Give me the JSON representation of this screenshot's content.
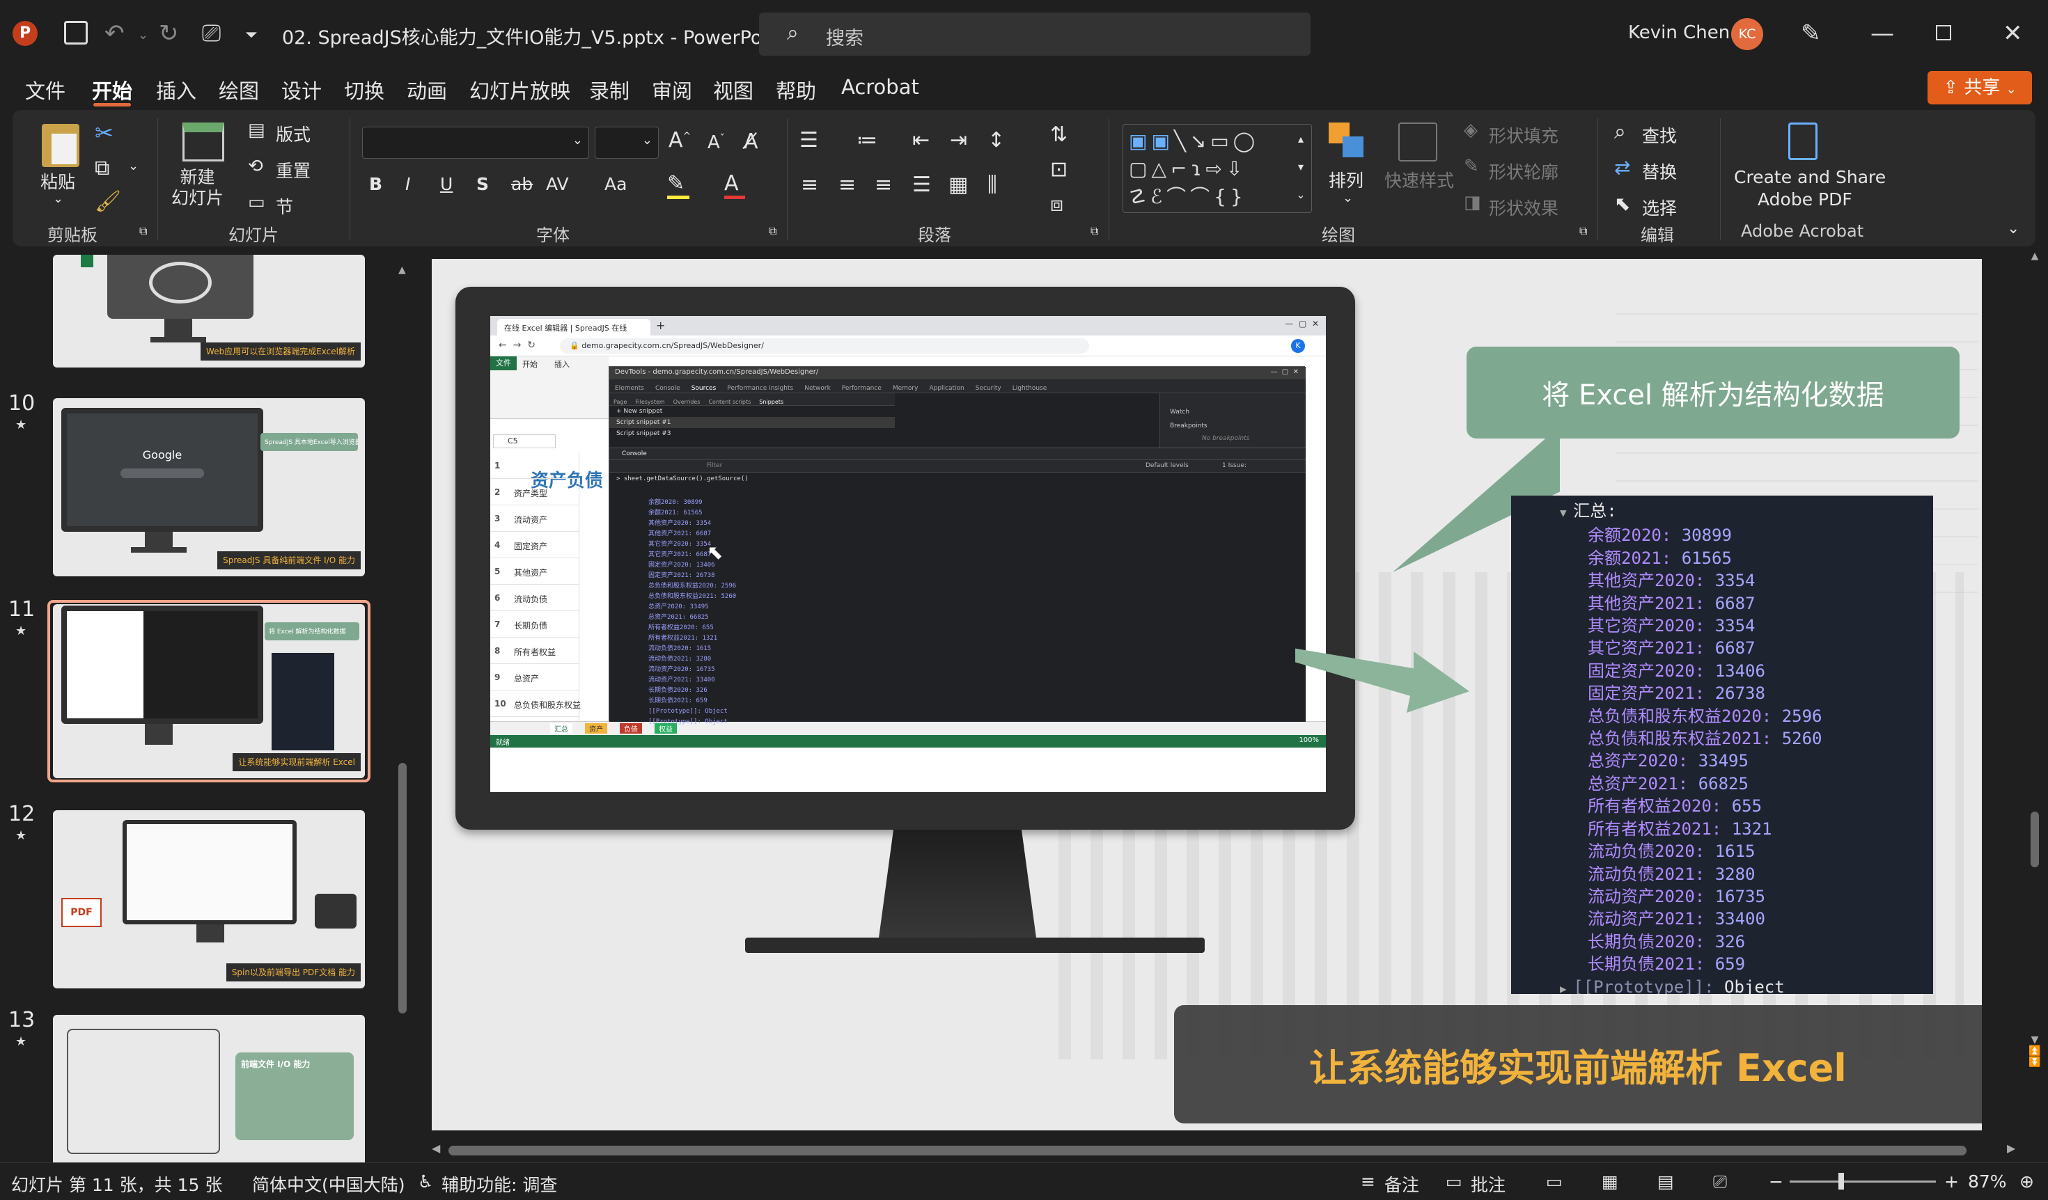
{
  "titlebar": {
    "app_icon": "powerpoint-icon",
    "filename": "02. SpreadJS核心能力_文件IO能力_V5.pptx",
    "separator": "-",
    "app_name": "PowerPoint",
    "search_placeholder": "搜索",
    "user_name": "Kevin Chen",
    "user_initials": "KC"
  },
  "menu": {
    "items": [
      "文件",
      "开始",
      "插入",
      "绘图",
      "设计",
      "切换",
      "动画",
      "幻灯片放映",
      "录制",
      "审阅",
      "视图",
      "帮助",
      "Acrobat"
    ],
    "active": "开始",
    "share_label": "共享"
  },
  "ribbon": {
    "clipboard": {
      "paste": "粘贴",
      "group": "剪贴板"
    },
    "slides": {
      "new_slide": "新建\n幻灯片",
      "layout": "版式",
      "reset": "重置",
      "section": "节",
      "group": "幻灯片"
    },
    "font": {
      "group": "字体",
      "aa": "Aa"
    },
    "paragraph": {
      "group": "段落"
    },
    "drawing": {
      "arrange": "排列",
      "quick_styles": "快速样式",
      "shape_fill": "形状填充",
      "shape_outline": "形状轮廓",
      "shape_effects": "形状效果",
      "group": "绘图"
    },
    "editing": {
      "find": "查找",
      "replace": "替换",
      "select": "选择",
      "group": "编辑"
    },
    "acrobat": {
      "create_share": "Create and Share",
      "adobe_pdf": "Adobe PDF",
      "group": "Adobe Acrobat"
    }
  },
  "thumbnails": [
    {
      "num": "",
      "banner": "Web应用可以在浏览器端完成Excel解析"
    },
    {
      "num": "10",
      "banner": "SpreadJS 具备纯前端文件 I/O 能力",
      "bubble": "SpreadJS 具本地Excel导入浏览器"
    },
    {
      "num": "11",
      "banner": "让系统能够实现前端解析 Excel",
      "bubble": "将 Excel 解析为结构化数据"
    },
    {
      "num": "12",
      "banner": "Spin以及前端导出 PDF文档 能力"
    },
    {
      "num": "13",
      "title": "前端文件 I/O 能力"
    }
  ],
  "slide": {
    "bubble_text": "将 Excel 解析为结构化数据",
    "bottom_banner": "让系统能够实现前端解析 Excel",
    "code_lines": [
      {
        "k": "汇总:",
        "v": "",
        "indent": 0
      },
      {
        "k": "余额2020:",
        "v": "30899",
        "indent": 1
      },
      {
        "k": "余额2021:",
        "v": "61565",
        "indent": 1
      },
      {
        "k": "其他资产2020:",
        "v": "3354",
        "indent": 1
      },
      {
        "k": "其他资产2021:",
        "v": "6687",
        "indent": 1
      },
      {
        "k": "其它资产2020:",
        "v": "3354",
        "indent": 1
      },
      {
        "k": "其它资产2021:",
        "v": "6687",
        "indent": 1
      },
      {
        "k": "固定资产2020:",
        "v": "13406",
        "indent": 1
      },
      {
        "k": "固定资产2021:",
        "v": "26738",
        "indent": 1
      },
      {
        "k": "总负债和股东权益2020:",
        "v": "2596",
        "indent": 1
      },
      {
        "k": "总负债和股东权益2021:",
        "v": "5260",
        "indent": 1
      },
      {
        "k": "总资产2020:",
        "v": "33495",
        "indent": 1
      },
      {
        "k": "总资产2021:",
        "v": "66825",
        "indent": 1
      },
      {
        "k": "所有者权益2020:",
        "v": "655",
        "indent": 1
      },
      {
        "k": "所有者权益2021:",
        "v": "1321",
        "indent": 1
      },
      {
        "k": "流动负债2020:",
        "v": "1615",
        "indent": 1
      },
      {
        "k": "流动负债2021:",
        "v": "3280",
        "indent": 1
      },
      {
        "k": "流动资产2020:",
        "v": "16735",
        "indent": 1
      },
      {
        "k": "流动资产2021:",
        "v": "33400",
        "indent": 1
      },
      {
        "k": "长期负债2020:",
        "v": "326",
        "indent": 1
      },
      {
        "k": "长期负债2021:",
        "v": "659",
        "indent": 1
      },
      {
        "k": "[[Prototype]]:",
        "v": "Object",
        "indent": 0
      }
    ],
    "browser": {
      "tab": "在线 Excel 编辑器 | SpreadJS 在线",
      "url": "demo.grapecity.com.cn/SpreadJS/WebDesigner/",
      "devtools_title": "DevTools - demo.grapecity.com.cn/SpreadJS/WebDesigner/",
      "dev_tabs": [
        "Elements",
        "Console",
        "Sources",
        "Performance insights",
        "Network",
        "Performance",
        "Memory",
        "Application",
        "Security",
        "Lighthouse"
      ],
      "sub_tabs": [
        "Page",
        "Filesystem",
        "Overrides",
        "Content scripts",
        "Snippets"
      ],
      "snippets": [
        "+ New snippet",
        "Script snippet #1",
        "Script snippet #3"
      ],
      "watch": "Watch",
      "breakpoints": "Breakpoints",
      "no_breakpoints": "No breakpoints",
      "console_label": "Console",
      "filter": "Filter",
      "levels": "Default levels",
      "issues": "1 Issue:",
      "command": "sheet.getDataSource().getSource()",
      "excel_tabs": [
        "文件",
        "开始",
        "插入"
      ],
      "cell_ref": "C5",
      "sheet_title": "资产负债",
      "rows": [
        "",
        "资产类型",
        "流动资产",
        "固定资产",
        "其他资产",
        "流动负债",
        "长期负债",
        "所有者权益",
        "总资产",
        "总负债和股东权益"
      ],
      "sheet_tabs": [
        "汇总",
        "资产",
        "负债",
        "权益"
      ],
      "status_left": "就绪",
      "zoom": "100%",
      "devtools_small_lines": [
        "余额2020: 30899",
        "余额2021: 61565",
        "其他资产2020: 3354",
        "其他资产2021: 6687",
        "其它资产2020: 3354",
        "其它资产2021: 6687",
        "固定资产2020: 13406",
        "固定资产2021: 26738",
        "总负债和股东权益2020: 2596",
        "总负债和股东权益2021: 5260",
        "总资产2020: 33495",
        "总资产2021: 66825",
        "所有者权益2020: 655",
        "所有者权益2021: 1321",
        "流动负债2020: 1615",
        "流动负债2021: 3280",
        "流动资产2020: 16735",
        "流动资产2021: 33400",
        "长期负债2020: 326",
        "长期负债2021: 659",
        "[[Prototype]]: Object",
        "[[Prototype]]: Object"
      ]
    }
  },
  "status": {
    "slide_info": "幻灯片 第 11 张，共 15 张",
    "language": "简体中文(中国大陆)",
    "accessibility": "辅助功能: 调查",
    "notes": "备注",
    "comments": "批注",
    "zoom": "87%"
  },
  "colors": {
    "accent": "#c43e1c",
    "share": "#e35d1a",
    "bubble": "#7fa890",
    "banner_text": "#f2b33d"
  }
}
